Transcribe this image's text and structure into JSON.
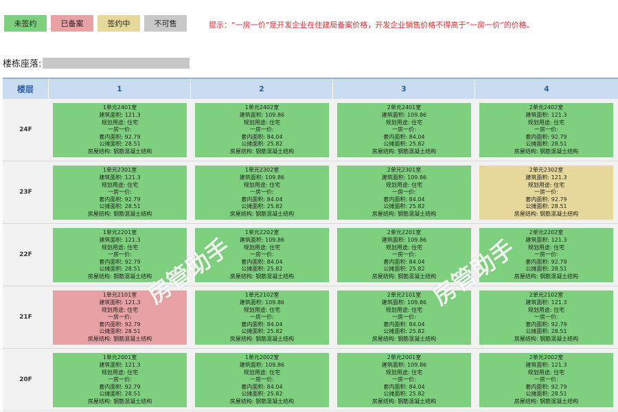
{
  "legend": [
    {
      "label": "未签约",
      "color": "#7ed07e"
    },
    {
      "label": "已备案",
      "color": "#e8a1a4"
    },
    {
      "label": "签约中",
      "color": "#e6d79a"
    },
    {
      "label": "不可售",
      "color": "#c8c8c8"
    }
  ],
  "hint": "提示：“一房一价”是开发企业在住建局备案价格，开发企业销售价格不得高于“一房一价”的价格。",
  "building": {
    "label": "楼栋座落:"
  },
  "table": {
    "floor_header": "楼层",
    "unit_headers": [
      "1",
      "2",
      "3",
      "4"
    ]
  },
  "field_labels": {
    "area": "建筑面积: ",
    "usage": "规划用途: ",
    "price": "一房一价:",
    "inner": "套内面积: ",
    "shared": "公摊面积: ",
    "struct": "房屋结构: "
  },
  "floors": [
    {
      "label": "24F",
      "rooms": [
        {
          "name": "1单元2401室",
          "area": "121.3",
          "usage": "住宅",
          "inner": "92.79",
          "shared": "28.51",
          "struct": "钢筋混凝土结构",
          "status": "未签约"
        },
        {
          "name": "1单元2402室",
          "area": "109.86",
          "usage": "住宅",
          "inner": "84.04",
          "shared": "25.82",
          "struct": "钢筋混凝土结构",
          "status": "未签约"
        },
        {
          "name": "2单元2401室",
          "area": "109.86",
          "usage": "住宅",
          "inner": "84.04",
          "shared": "25.82",
          "struct": "钢筋混凝土结构",
          "status": "未签约"
        },
        {
          "name": "2单元2402室",
          "area": "121.3",
          "usage": "住宅",
          "inner": "92.79",
          "shared": "28.51",
          "struct": "钢筋混凝土结构",
          "status": "未签约"
        }
      ]
    },
    {
      "label": "23F",
      "rooms": [
        {
          "name": "1单元2301室",
          "area": "121.3",
          "usage": "住宅",
          "inner": "92.79",
          "shared": "28.51",
          "struct": "钢筋混凝土结构",
          "status": "未签约"
        },
        {
          "name": "1单元2302室",
          "area": "109.86",
          "usage": "住宅",
          "inner": "84.04",
          "shared": "25.82",
          "struct": "钢筋混凝土结构",
          "status": "未签约"
        },
        {
          "name": "2单元2301室",
          "area": "109.86",
          "usage": "住宅",
          "inner": "84.04",
          "shared": "25.82",
          "struct": "钢筋混凝土结构",
          "status": "未签约"
        },
        {
          "name": "2单元2302室",
          "area": "121.3",
          "usage": "住宅",
          "inner": "92.79",
          "shared": "28.51",
          "struct": "钢筋混凝土结构",
          "status": "签约中"
        }
      ]
    },
    {
      "label": "22F",
      "rooms": [
        {
          "name": "1单元2201室",
          "area": "121.3",
          "usage": "住宅",
          "inner": "92.79",
          "shared": "28.51",
          "struct": "钢筋混凝土结构",
          "status": "未签约"
        },
        {
          "name": "1单元2202室",
          "area": "109.86",
          "usage": "住宅",
          "inner": "84.04",
          "shared": "25.82",
          "struct": "钢筋混凝土结构",
          "status": "未签约"
        },
        {
          "name": "2单元2201室",
          "area": "109.86",
          "usage": "住宅",
          "inner": "84.04",
          "shared": "25.82",
          "struct": "钢筋混凝土结构",
          "status": "未签约"
        },
        {
          "name": "2单元2202室",
          "area": "121.3",
          "usage": "住宅",
          "inner": "92.79",
          "shared": "28.51",
          "struct": "钢筋混凝土结构",
          "status": "未签约"
        }
      ]
    },
    {
      "label": "21F",
      "rooms": [
        {
          "name": "1单元2101室",
          "area": "121.3",
          "usage": "住宅",
          "inner": "92.79",
          "shared": "28.51",
          "struct": "钢筋混凝土结构",
          "status": "已备案"
        },
        {
          "name": "1单元2102室",
          "area": "109.86",
          "usage": "住宅",
          "inner": "84.04",
          "shared": "25.82",
          "struct": "钢筋混凝土结构",
          "status": "未签约"
        },
        {
          "name": "2单元2101室",
          "area": "109.86",
          "usage": "住宅",
          "inner": "84.04",
          "shared": "25.82",
          "struct": "钢筋混凝土结构",
          "status": "未签约"
        },
        {
          "name": "2单元2102室",
          "area": "121.3",
          "usage": "住宅",
          "inner": "92.79",
          "shared": "28.51",
          "struct": "钢筋混凝土结构",
          "status": "未签约"
        }
      ]
    },
    {
      "label": "20F",
      "rooms": [
        {
          "name": "1单元2001室",
          "area": "121.3",
          "usage": "住宅",
          "inner": "92.79",
          "shared": "28.51",
          "struct": "钢筋混凝土结构",
          "status": "未签约"
        },
        {
          "name": "1单元2002室",
          "area": "109.86",
          "usage": "住宅",
          "inner": "84.04",
          "shared": "25.82",
          "struct": "钢筋混凝土结构",
          "status": "未签约"
        },
        {
          "name": "2单元2001室",
          "area": "109.86",
          "usage": "住宅",
          "inner": "84.04",
          "shared": "25.82",
          "struct": "钢筋混凝土结构",
          "status": "未签约"
        },
        {
          "name": "2单元2002室",
          "area": "121.3",
          "usage": "住宅",
          "inner": "92.79",
          "shared": "28.51",
          "struct": "钢筋混凝土结构",
          "status": "未签约"
        }
      ]
    }
  ],
  "watermark": "房管助手"
}
